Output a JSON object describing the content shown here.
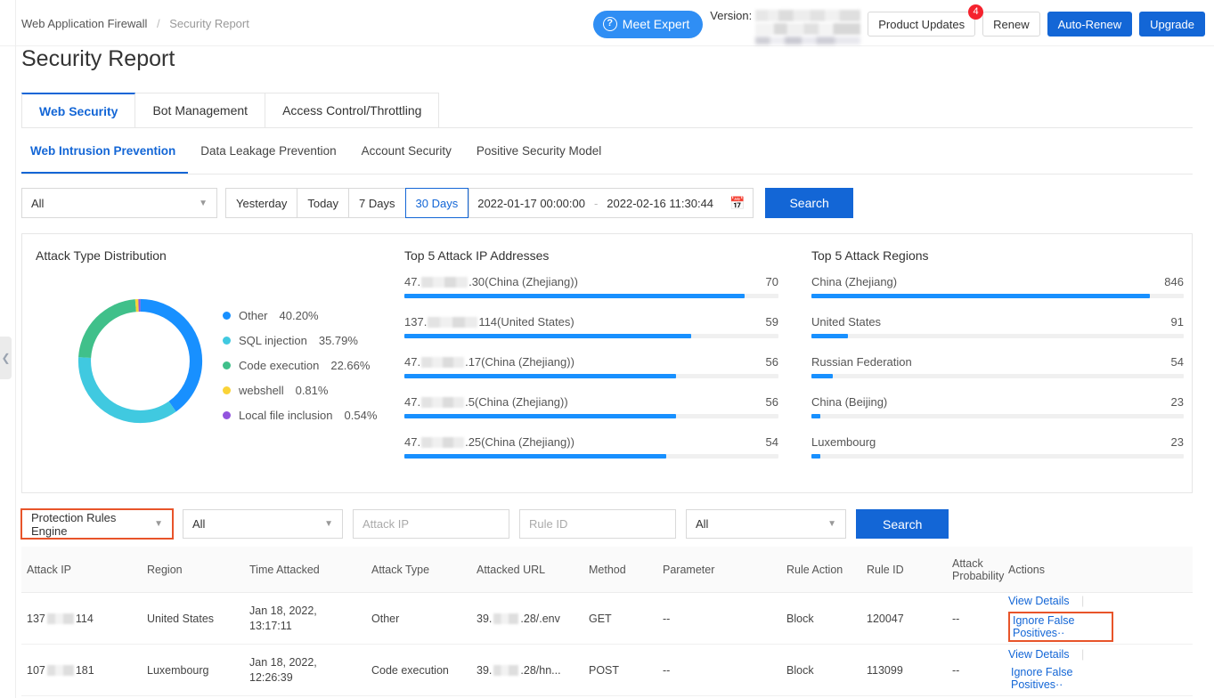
{
  "header": {
    "breadcrumb": {
      "root": "Web Application Firewall",
      "separator": "/",
      "current": "Security Report"
    },
    "meet_expert": "Meet Expert",
    "meet_expert_icon": "question-circle-icon",
    "version_label": "Version:",
    "product_updates": "Product Updates",
    "product_updates_badge": "4",
    "renew": "Renew",
    "auto_renew": "Auto-Renew",
    "upgrade": "Upgrade"
  },
  "page_title": "Security Report",
  "card_tabs": [
    {
      "label": "Web Security",
      "active": true
    },
    {
      "label": "Bot Management",
      "active": false
    },
    {
      "label": "Access Control/Throttling",
      "active": false
    }
  ],
  "sub_tabs": [
    {
      "label": "Web Intrusion Prevention",
      "active": true
    },
    {
      "label": "Data Leakage Prevention",
      "active": false
    },
    {
      "label": "Account Security",
      "active": false
    },
    {
      "label": "Positive Security Model",
      "active": false
    }
  ],
  "filter_bar": {
    "domain_select": "All",
    "ranges": [
      {
        "label": "Yesterday",
        "active": false
      },
      {
        "label": "Today",
        "active": false
      },
      {
        "label": "7 Days",
        "active": false
      },
      {
        "label": "30 Days",
        "active": true
      }
    ],
    "date_start": "2022-01-17 00:00:00",
    "date_separator": "-",
    "date_end": "2022-02-16 11:30:44",
    "calendar_icon": "calendar-icon",
    "search": "Search"
  },
  "chart_data": [
    {
      "type": "pie",
      "title": "Attack Type Distribution",
      "labels": [
        "Other",
        "SQL injection",
        "Code execution",
        "webshell",
        "Local file inclusion"
      ],
      "values": [
        40.2,
        35.79,
        22.66,
        0.81,
        0.54
      ],
      "value_labels": [
        "40.20%",
        "35.79%",
        "22.66%",
        "0.81%",
        "0.54%"
      ],
      "colors": [
        "#1890ff",
        "#40c9e0",
        "#40c08a",
        "#fad337",
        "#9254de"
      ],
      "legend_position": "right",
      "donut": true
    },
    {
      "type": "bar",
      "title": "Top 5 Attack IP Addresses",
      "orientation": "horizontal",
      "categories": [
        "47.    .30(China (Zhejiang))",
        "137.    114(United States)",
        "47.    .17(China (Zhejiang))",
        "47.    .5(China (Zhejiang))",
        "47.    .25(China (Zhejiang))"
      ],
      "category_parts": [
        {
          "prefix": "47.",
          "redacted": true,
          "suffix": ".30(China (Zhejiang))"
        },
        {
          "prefix": "137.",
          "redacted": true,
          "suffix": "114(United States)"
        },
        {
          "prefix": "47.",
          "redacted": true,
          "suffix": ".17(China (Zhejiang))"
        },
        {
          "prefix": "47.",
          "redacted": true,
          "suffix": ".5(China (Zhejiang))"
        },
        {
          "prefix": "47.",
          "redacted": true,
          "suffix": ".25(China (Zhejiang))"
        }
      ],
      "values": [
        70,
        59,
        56,
        56,
        54
      ],
      "max": 77,
      "bar_color": "#1890ff",
      "track_color": "#f0f0f0"
    },
    {
      "type": "bar",
      "title": "Top 5 Attack Regions",
      "orientation": "horizontal",
      "categories": [
        "China (Zhejiang)",
        "United States",
        "Russian Federation",
        "China (Beijing)",
        "Luxembourg"
      ],
      "values": [
        846,
        91,
        54,
        23,
        23
      ],
      "max": 930,
      "bar_color": "#1890ff",
      "track_color": "#f0f0f0"
    }
  ],
  "filter_bar2": {
    "engine_select": "Protection Rules Engine",
    "type_select": "All",
    "attack_ip_placeholder": "Attack IP",
    "rule_id_placeholder": "Rule ID",
    "action_select": "All",
    "search": "Search"
  },
  "table": {
    "columns": [
      "Attack IP",
      "Region",
      "Time Attacked",
      "Attack Type",
      "Attacked URL",
      "Method",
      "Parameter",
      "Rule Action",
      "Rule ID",
      "Attack Probability",
      "Actions"
    ],
    "rows": [
      {
        "attack_ip_prefix": "137",
        "attack_ip_suffix": "114",
        "region": "United States",
        "time_attacked_line1": "Jan 18, 2022,",
        "time_attacked_line2": "13:17:11",
        "attack_type": "Other",
        "url_prefix": "39.",
        "url_suffix": ".28/.env",
        "method": "GET",
        "parameter": "--",
        "rule_action": "Block",
        "rule_id": "120047",
        "attack_probability": "--",
        "action_view": "View Details",
        "action_ignore": "Ignore False Positives··",
        "ignore_highlighted": true
      },
      {
        "attack_ip_prefix": "107",
        "attack_ip_suffix": "181",
        "region": "Luxembourg",
        "time_attacked_line1": "Jan 18, 2022,",
        "time_attacked_line2": "12:26:39",
        "attack_type": "Code execution",
        "url_prefix": "39.",
        "url_suffix": ".28/hn...",
        "method": "POST",
        "parameter": "--",
        "rule_action": "Block",
        "rule_id": "113099",
        "attack_probability": "--",
        "action_view": "View Details",
        "action_ignore": "Ignore False Positives··",
        "ignore_highlighted": false
      }
    ]
  },
  "sidebar_toggle": {
    "icon": "chevron-left-icon"
  },
  "colors": {
    "primary": "#1366d6",
    "link": "#1366d6",
    "accent_bar": "#1890ff",
    "highlight": "#e8542a",
    "badge": "#f5222d"
  }
}
